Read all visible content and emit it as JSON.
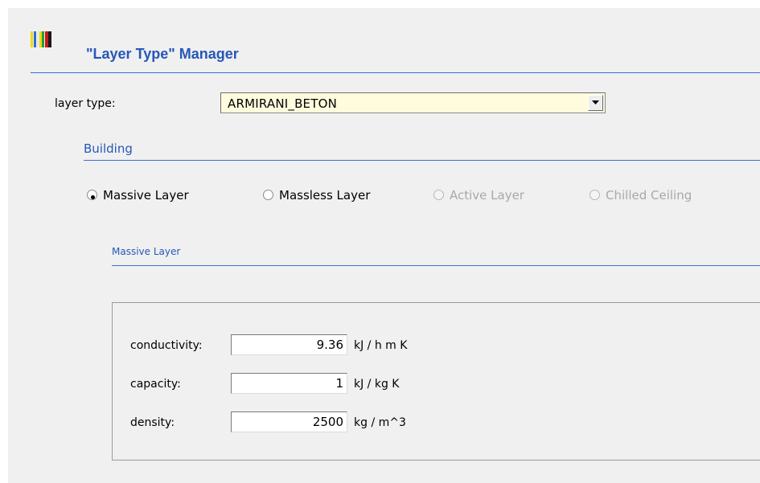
{
  "header": {
    "title": "\"Layer Type\" Manager",
    "logo_colors": [
      "#f5d800",
      "#2a6ed8",
      "#e8e8e8",
      "#20a040",
      "#c81818"
    ]
  },
  "layer_type": {
    "label": "layer type:",
    "value": "ARMIRANI_BETON"
  },
  "building": {
    "heading": "Building",
    "options": [
      {
        "label": "Massive Layer",
        "selected": true,
        "enabled": true
      },
      {
        "label": "Massless Layer",
        "selected": false,
        "enabled": true
      },
      {
        "label": "Active Layer",
        "selected": false,
        "enabled": false
      },
      {
        "label": "Chilled Ceiling",
        "selected": false,
        "enabled": false
      }
    ]
  },
  "massive_layer": {
    "heading": "Massive Layer",
    "properties": [
      {
        "label": "conductivity:",
        "value": "9.36",
        "unit": "kJ / h m K"
      },
      {
        "label": "capacity:",
        "value": "1",
        "unit": "kJ / kg K"
      },
      {
        "label": "density:",
        "value": "2500",
        "unit": "kg / m^3"
      }
    ]
  },
  "theme": {
    "accent": "#2657b7",
    "select_bg": "#fffbdd",
    "panel_bg": "#f0f0f0"
  }
}
